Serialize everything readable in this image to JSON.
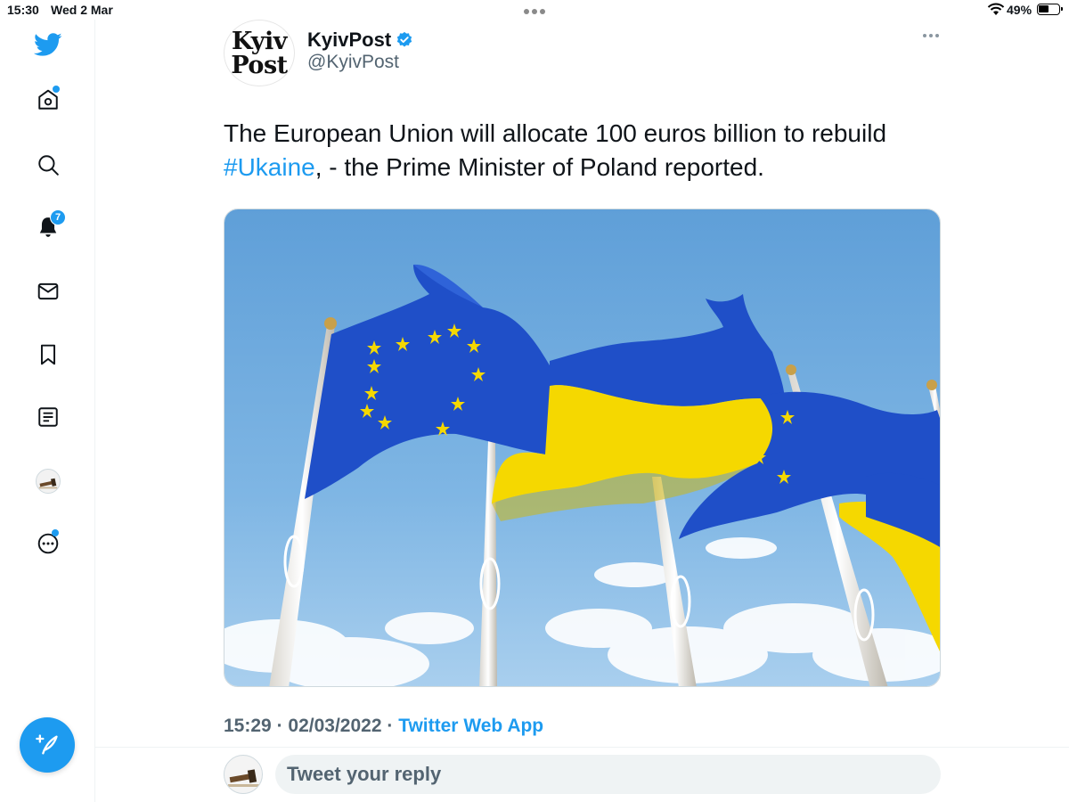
{
  "status_bar": {
    "time": "15:30",
    "date": "Wed 2 Mar",
    "battery": "49%"
  },
  "sidebar": {
    "items": [
      {
        "name": "twitter-logo",
        "icon": "bird-icon"
      },
      {
        "name": "home",
        "icon": "home-icon",
        "has_dot": true
      },
      {
        "name": "explore",
        "icon": "search-icon"
      },
      {
        "name": "notifications",
        "icon": "bell-icon",
        "badge": "7"
      },
      {
        "name": "messages",
        "icon": "envelope-icon"
      },
      {
        "name": "bookmarks",
        "icon": "bookmark-icon"
      },
      {
        "name": "lists",
        "icon": "list-icon"
      },
      {
        "name": "profile",
        "icon": "avatar"
      },
      {
        "name": "more",
        "icon": "more-circle-icon",
        "has_dot": true
      }
    ],
    "compose_icon": "feather-plus-icon"
  },
  "tweet": {
    "author_logo_line1": "Kyiv",
    "author_logo_line2": "Post",
    "author_name": "KyivPost",
    "verified": true,
    "author_handle": "@KyivPost",
    "text_before": "The European Union will allocate 100 euros billion to rebuild ",
    "hashtag": "#Ukaine",
    "text_after": ", - the Prime Minister of Poland reported.",
    "image_description": "EU and Ukrainian flags on flagpoles against a blue sky",
    "time": "15:29",
    "separator": "·",
    "date": "02/03/2022",
    "source": "Twitter Web App"
  },
  "reply": {
    "placeholder": "Tweet your reply"
  },
  "colors": {
    "accent": "#1d9bf0",
    "text": "#0f1419",
    "secondary": "#536471",
    "eu_blue": "#1f4fc8",
    "ua_yellow": "#f5d800"
  }
}
